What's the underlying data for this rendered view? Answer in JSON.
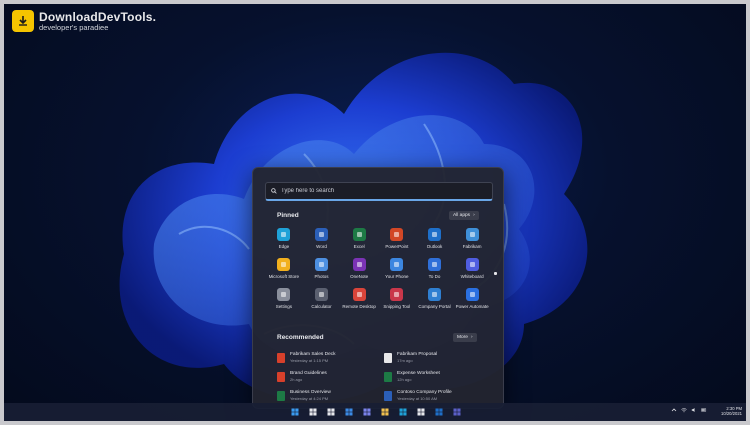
{
  "watermark": {
    "title": "DownloadDevTools.",
    "subtitle": "developer's paradiee"
  },
  "start_menu": {
    "search": {
      "placeholder": "Type here to search"
    },
    "pinned": {
      "title": "Pinned",
      "all_apps": "All apps",
      "apps": [
        {
          "label": "Edge",
          "icon": "edge-icon",
          "color": "#1fa2d8"
        },
        {
          "label": "Word",
          "icon": "word-icon",
          "color": "#2b5fb8"
        },
        {
          "label": "Excel",
          "icon": "excel-icon",
          "color": "#1d7a45"
        },
        {
          "label": "PowerPoint",
          "icon": "powerpoint-icon",
          "color": "#d24726"
        },
        {
          "label": "Outlook",
          "icon": "outlook-icon",
          "color": "#1e6fc9"
        },
        {
          "label": "Fabrikam",
          "icon": "fabrikam-icon",
          "color": "#3f8fd8"
        },
        {
          "label": "Microsoft Store",
          "icon": "store-icon",
          "color": "#f2b01e"
        },
        {
          "label": "Photos",
          "icon": "photos-icon",
          "color": "#4d8fe0"
        },
        {
          "label": "OneNote",
          "icon": "onenote-icon",
          "color": "#7b33b5"
        },
        {
          "label": "Your Phone",
          "icon": "phone-icon",
          "color": "#3c86e0"
        },
        {
          "label": "To Do",
          "icon": "todo-icon",
          "color": "#2f6fd8"
        },
        {
          "label": "Whiteboard",
          "icon": "whiteboard-icon",
          "color": "#4f5de0"
        },
        {
          "label": "Settings",
          "icon": "gear-icon",
          "color": "#8a8f9c"
        },
        {
          "label": "Calculator",
          "icon": "calculator-icon",
          "color": "#5b6070"
        },
        {
          "label": "Remote Desktop",
          "icon": "remote-desktop-icon",
          "color": "#d9443a"
        },
        {
          "label": "Snipping Tool",
          "icon": "snipping-tool-icon",
          "color": "#c9374a"
        },
        {
          "label": "Company Portal",
          "icon": "company-portal-icon",
          "color": "#2f7fd1"
        },
        {
          "label": "Power Automate",
          "icon": "power-automate-icon",
          "color": "#2a6fe0"
        }
      ]
    },
    "recommended": {
      "title": "Recommended",
      "more": "More",
      "items": [
        {
          "name": "Fabrikam Sales Deck",
          "time": "Yesterday at 1:15 PM",
          "icon": "pdf-file-icon",
          "color": "#d7402b"
        },
        {
          "name": "Fabrikam Proposal",
          "time": "17m ago",
          "icon": "word-file-icon",
          "color": "#e8e8ea"
        },
        {
          "name": "Brand Guidelines",
          "time": "2h ago",
          "icon": "pdf-file-icon",
          "color": "#d7402b"
        },
        {
          "name": "Expense Worksheet",
          "time": "12h ago",
          "icon": "excel-file-icon",
          "color": "#1d7a45"
        },
        {
          "name": "Business Overview",
          "time": "Yesterday at 4:24 PM",
          "icon": "excel-file-icon",
          "color": "#1d7a45"
        },
        {
          "name": "Contoso Company Profile",
          "time": "Yesterday at 10:50 AM",
          "icon": "word-file-icon",
          "color": "#2b5fb8"
        }
      ]
    }
  },
  "taskbar": {
    "apps": [
      {
        "icon": "windows-start-icon",
        "color": "#3a9bf0"
      },
      {
        "icon": "search-icon",
        "color": "#e6e7ec"
      },
      {
        "icon": "task-view-icon",
        "color": "#e6e7ec"
      },
      {
        "icon": "widgets-icon",
        "color": "#3b8be6"
      },
      {
        "icon": "teams-chat-icon",
        "color": "#7b83eb"
      },
      {
        "icon": "file-explorer-icon",
        "color": "#f2c14e"
      },
      {
        "icon": "edge-icon",
        "color": "#1fa2d8"
      },
      {
        "icon": "store-icon",
        "color": "#e6e7ec"
      },
      {
        "icon": "outlook-icon",
        "color": "#1e6fc9"
      },
      {
        "icon": "teams-icon",
        "color": "#5b5fc7"
      }
    ],
    "clock": {
      "time": "2:30 PM",
      "date": "10/20/2021"
    }
  }
}
